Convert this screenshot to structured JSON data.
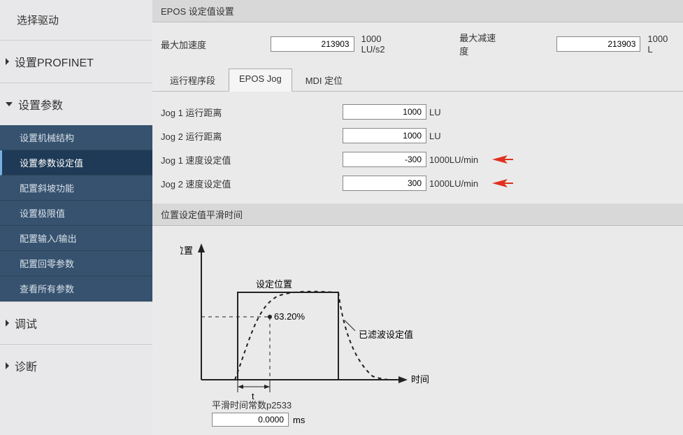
{
  "sidebar": {
    "header": "选择驱动",
    "sections": [
      {
        "title": "设置PROFINET",
        "expanded": false
      },
      {
        "title": "设置参数",
        "expanded": true,
        "items": [
          {
            "label": "设置机械结构"
          },
          {
            "label": "设置参数设定值",
            "active": true
          },
          {
            "label": "配置斜坡功能"
          },
          {
            "label": "设置极限值"
          },
          {
            "label": "配置输入/输出"
          },
          {
            "label": "配置回零参数"
          },
          {
            "label": "查看所有参数"
          }
        ]
      },
      {
        "title": "调试",
        "expanded": false
      },
      {
        "title": "诊断",
        "expanded": false
      }
    ]
  },
  "panel": {
    "title": "EPOS 设定值设置",
    "max_accel_label": "最大加速度",
    "max_accel_value": "213903",
    "max_accel_unit": "1000 LU/s2",
    "max_decel_label": "最大减速度",
    "max_decel_value": "213903",
    "max_decel_unit": "1000 L"
  },
  "tabs": [
    {
      "label": "运行程序段"
    },
    {
      "label": "EPOS Jog",
      "active": true
    },
    {
      "label": "MDI 定位"
    }
  ],
  "jog": {
    "rows": [
      {
        "label": "Jog 1 运行距离",
        "value": "1000",
        "unit": "LU"
      },
      {
        "label": "Jog 2 运行距离",
        "value": "1000",
        "unit": "LU"
      },
      {
        "label": "Jog 1 速度设定值",
        "value": "-300",
        "unit": "1000LU/min",
        "arrow": true
      },
      {
        "label": "Jog 2 速度设定值",
        "value": "300",
        "unit": "1000LU/min",
        "arrow": true
      }
    ]
  },
  "smoothing": {
    "panel_title": "位置设定值平滑时间",
    "y_axis": "位置",
    "x_axis": "时间",
    "setpoint_label": "设定位置",
    "filtered_label": "已滤波设定值",
    "percent": "63.20%",
    "t_label": "t",
    "param_label": "平滑时间常数p2533",
    "param_value": "0.0000",
    "param_unit": "ms"
  },
  "chart_data": {
    "type": "line",
    "title": "位置设定值平滑时间",
    "xlabel": "时间",
    "ylabel": "位置",
    "series": [
      {
        "name": "设定位置",
        "type": "step",
        "points": [
          [
            0,
            0
          ],
          [
            1,
            0
          ],
          [
            1,
            1
          ],
          [
            3,
            1
          ],
          [
            3,
            0
          ]
        ]
      },
      {
        "name": "已滤波设定值",
        "type": "exponential",
        "percent_at_t": 63.2,
        "points": [
          [
            0.9,
            0
          ],
          [
            1.4,
            0.63
          ],
          [
            2.2,
            0.95
          ],
          [
            3,
            1
          ],
          [
            3.2,
            0.8
          ],
          [
            3.6,
            0.2
          ],
          [
            4.2,
            0
          ]
        ]
      }
    ],
    "annotations": [
      {
        "text": "63.20%",
        "y_fraction": 0.632
      },
      {
        "text": "t",
        "marks": "time constant interval"
      }
    ]
  }
}
